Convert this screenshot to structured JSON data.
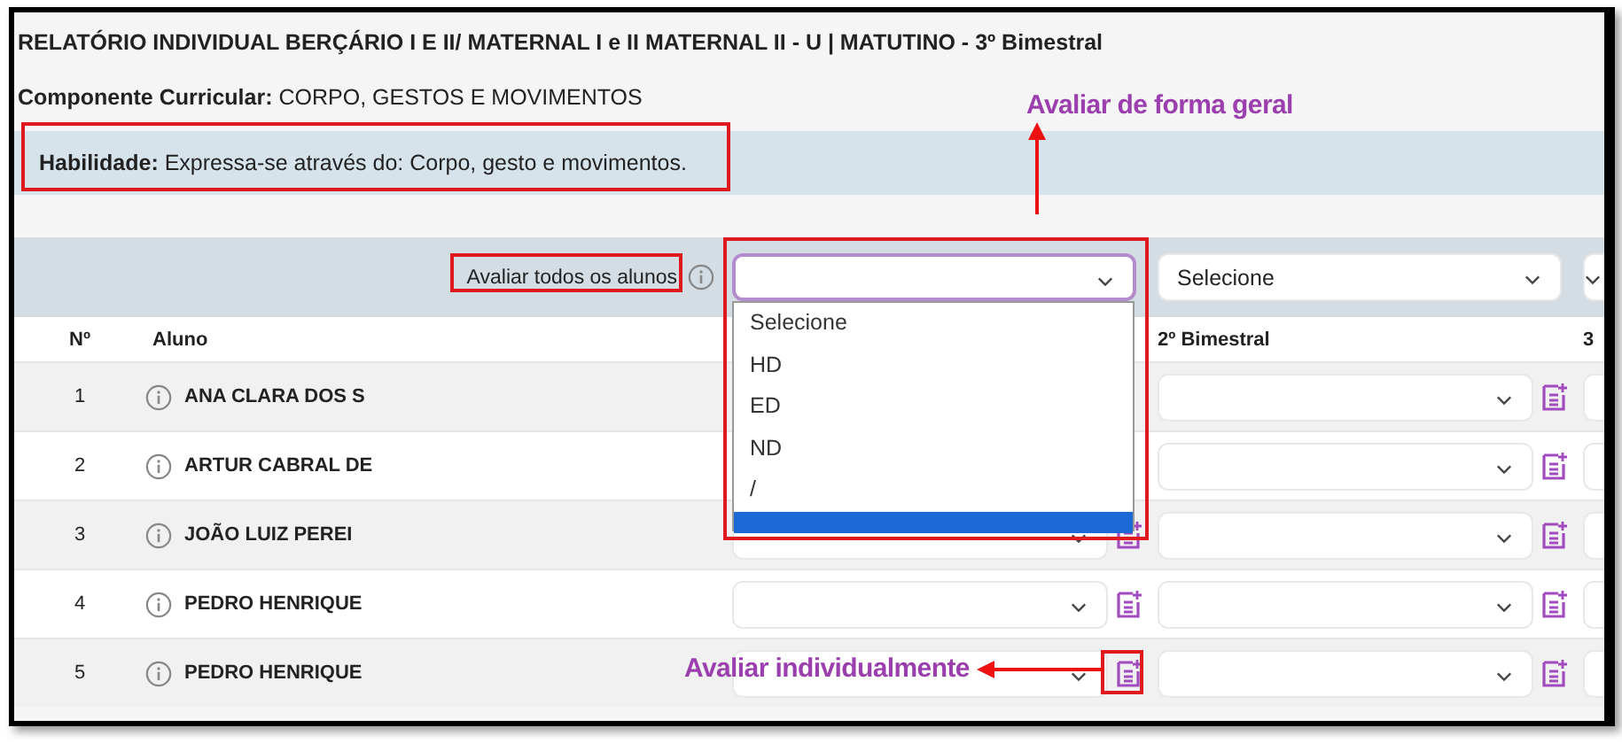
{
  "report": {
    "title": "RELATÓRIO INDIVIDUAL BERÇÁRIO I E II/ MATERNAL I e II MATERNAL II - U | MATUTINO - 3º Bimestral",
    "component": "**Componente Curricular:** CORPO, GESTOS E MOVIMENTOS",
    "skill": "**Habilidade:** Expressa-se através do: Corpo, gesto e movimentos."
  },
  "bulk": {
    "label": "Avaliar todos os alunos",
    "selects": [
      {
        "focused": true
      },
      {
        "value": "Selecione",
        "focused": false
      },
      {
        "focused": false
      }
    ]
  },
  "dropdown": {
    "options": [
      {
        "label": "Selecione",
        "selected": false
      },
      {
        "label": "HD",
        "selected": false
      },
      {
        "label": "ED",
        "selected": false
      },
      {
        "label": "ND",
        "selected": false
      },
      {
        "label": "/",
        "selected": false
      },
      {
        "selected": true
      }
    ]
  },
  "headers": {
    "number": "Nº",
    "student": "Aluno",
    "term_2": "2º Bimestral",
    "column_5": "3"
  },
  "rows": [
    {
      "number": "1",
      "name": "ANA CLARA DOS S",
      "under_dropdown": true
    },
    {
      "number": "2",
      "name": "ARTUR CABRAL DE",
      "under_dropdown": true
    },
    {
      "number": "3",
      "name": "JOÃO LUIZ PEREI",
      "under_dropdown": false
    },
    {
      "number": "4",
      "name": "PEDRO HENRIQUE",
      "under_dropdown": false
    },
    {
      "number": "5",
      "name": "PEDRO HENRIQUE",
      "under_dropdown": false
    }
  ],
  "annotations": [
    {
      "text": "Avaliar de forma geral",
      "kind": "up"
    },
    {
      "text": "Avaliar individualmente",
      "kind": "left"
    }
  ]
}
